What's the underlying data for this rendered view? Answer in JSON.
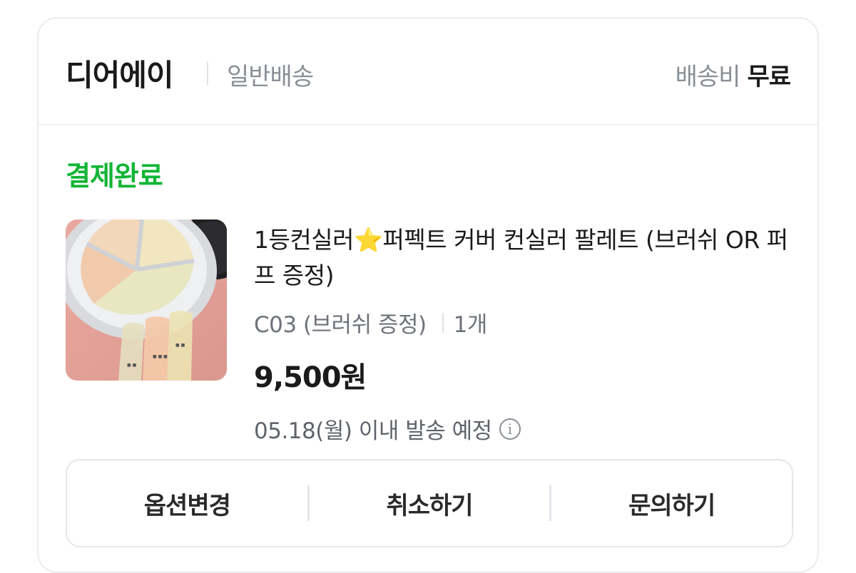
{
  "header": {
    "seller_name": "디어에이",
    "delivery_type": "일반배송",
    "shipping_fee_label": "배송비",
    "shipping_fee_value": "무료"
  },
  "order": {
    "status": "결제완료",
    "status_color": "#12b535"
  },
  "product": {
    "title_part1": "1등컨실러",
    "title_star": "⭐",
    "title_part2": "퍼펙트 커버 컨실러 팔레트 (브러쉬 OR 퍼프 증정)",
    "option": "C03 (브러쉬 증정)",
    "quantity": "1개",
    "price": "9,500원",
    "ship_date": "05.18(월) 이내 발송 예정",
    "info_icon": "info-icon"
  },
  "actions": {
    "change_option": "옵션변경",
    "cancel": "취소하기",
    "inquiry": "문의하기"
  }
}
